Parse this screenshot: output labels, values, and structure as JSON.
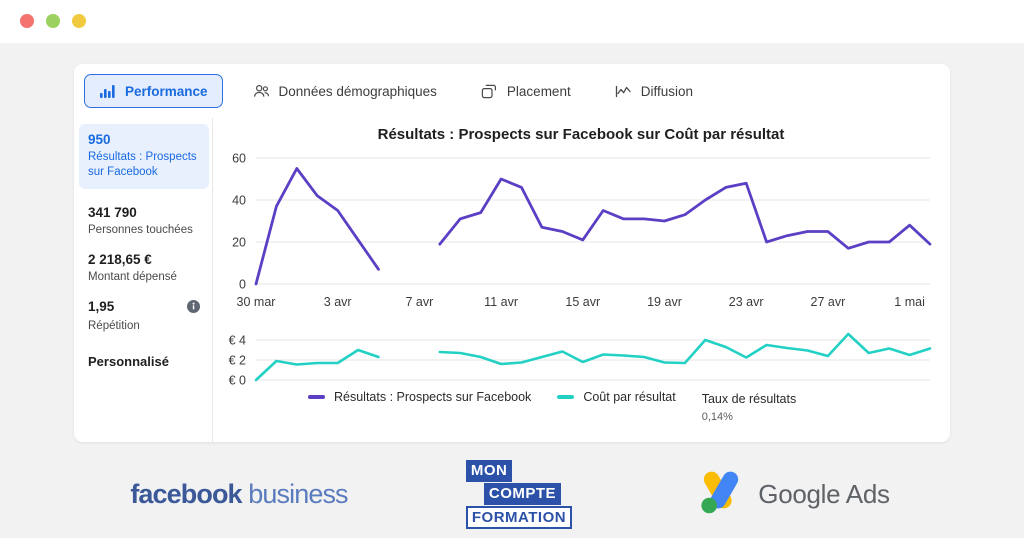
{
  "window": {
    "dots": [
      {
        "name": "close-dot",
        "color": "#f4736e"
      },
      {
        "name": "minimize-dot",
        "color": "#9bd15e"
      },
      {
        "name": "maximize-dot",
        "color": "#f0cb3f"
      }
    ]
  },
  "tabs": [
    {
      "label": "Performance",
      "icon": "bar-chart-icon",
      "active": true
    },
    {
      "label": "Données démographiques",
      "icon": "people-group-icon",
      "active": false
    },
    {
      "label": "Placement",
      "icon": "overlapping-squares-icon",
      "active": false
    },
    {
      "label": "Diffusion",
      "icon": "line-chart-icon",
      "active": false
    }
  ],
  "metrics": [
    {
      "value": "950",
      "label": "Résultats : Prospects sur Facebook",
      "highlighted": true,
      "info": false
    },
    {
      "value": "341 790",
      "label": "Personnes touchées",
      "highlighted": false,
      "info": false
    },
    {
      "value": "2 218,65 €",
      "label": "Montant dépensé",
      "highlighted": false,
      "info": false
    },
    {
      "value": "1,95",
      "label": "Répétition",
      "highlighted": false,
      "info": true
    }
  ],
  "custom_label": "Personnalisé",
  "legend": {
    "series": [
      {
        "label": "Résultats : Prospects sur Facebook",
        "color": "#5b3fc4"
      },
      {
        "label": "Coût par résultat",
        "color": "#22d0c4"
      }
    ],
    "rate_label": "Taux de résultats",
    "rate_value": "0,14%"
  },
  "logos": {
    "facebook": {
      "bold": "facebook",
      "light": " business"
    },
    "moncompteformation": {
      "line1": "MON",
      "line2": "COMPTE",
      "line3": "FORMATION"
    },
    "googleads": {
      "text": "Google Ads"
    }
  },
  "chart_data": [
    {
      "type": "line",
      "title": "Résultats : Prospects sur Facebook sur Coût par résultat",
      "name": "Résultats : Prospects sur Facebook",
      "color": "#5b3fc4",
      "xlabel": "",
      "ylabel": "",
      "ylim": [
        0,
        60
      ],
      "yticks": [
        0,
        20,
        40,
        60
      ],
      "ytick_labels": [
        "0",
        "20",
        "40",
        "60"
      ],
      "grid": true,
      "legend_position": "bottom",
      "x": [
        "30 mar",
        "31 mar",
        "1 avr",
        "2 avr",
        "3 avr",
        "4 avr",
        "5 avr",
        "6 avr",
        "7 avr",
        "8 avr",
        "9 avr",
        "10 avr",
        "11 avr",
        "12 avr",
        "13 avr",
        "14 avr",
        "15 avr",
        "16 avr",
        "17 avr",
        "18 avr",
        "19 avr",
        "20 avr",
        "21 avr",
        "22 avr",
        "23 avr",
        "24 avr",
        "25 avr",
        "26 avr",
        "27 avr",
        "28 avr",
        "29 avr",
        "30 avr",
        "1 mai",
        "2 mai"
      ],
      "xtick_labels": [
        "30 mar",
        "3 avr",
        "7 avr",
        "11 avr",
        "15 avr",
        "19 avr",
        "23 avr",
        "27 avr",
        "1 mai"
      ],
      "xtick_indices": [
        0,
        4,
        8,
        12,
        16,
        20,
        24,
        28,
        32
      ],
      "values": [
        0,
        37,
        55,
        42,
        35,
        21,
        7,
        null,
        null,
        19,
        31,
        34,
        50,
        46,
        27,
        25,
        21,
        35,
        31,
        31,
        30,
        33,
        40,
        46,
        48,
        20,
        23,
        25,
        25,
        17,
        20,
        20,
        28,
        19
      ],
      "gap_after_index": 6,
      "gap_resume_index": 9
    },
    {
      "type": "line",
      "title": "",
      "name": "Coût par résultat",
      "color": "#22d0c4",
      "xlabel": "",
      "ylabel": "",
      "ylim": [
        0,
        5
      ],
      "yticks": [
        0,
        2,
        4
      ],
      "ytick_labels": [
        "€ 0",
        "€ 2",
        "€ 4"
      ],
      "grid": true,
      "currency": "€",
      "x": [
        "30 mar",
        "31 mar",
        "1 avr",
        "2 avr",
        "3 avr",
        "4 avr",
        "5 avr",
        "6 avr",
        "7 avr",
        "8 avr",
        "9 avr",
        "10 avr",
        "11 avr",
        "12 avr",
        "13 avr",
        "14 avr",
        "15 avr",
        "16 avr",
        "17 avr",
        "18 avr",
        "19 avr",
        "20 avr",
        "21 avr",
        "22 avr",
        "23 avr",
        "24 avr",
        "25 avr",
        "26 avr",
        "27 avr",
        "28 avr",
        "29 avr",
        "30 avr",
        "1 mai",
        "2 mai"
      ],
      "values": [
        0,
        1.9,
        1.55,
        1.7,
        1.7,
        3.0,
        2.3,
        null,
        null,
        2.8,
        2.7,
        2.3,
        1.6,
        1.75,
        2.3,
        2.85,
        1.8,
        2.55,
        2.45,
        2.3,
        1.75,
        1.7,
        4.0,
        3.3,
        2.25,
        3.5,
        3.2,
        2.95,
        2.4,
        4.6,
        2.7,
        3.15,
        2.5,
        3.15
      ],
      "gap_after_index": 6,
      "gap_resume_index": 9
    }
  ]
}
